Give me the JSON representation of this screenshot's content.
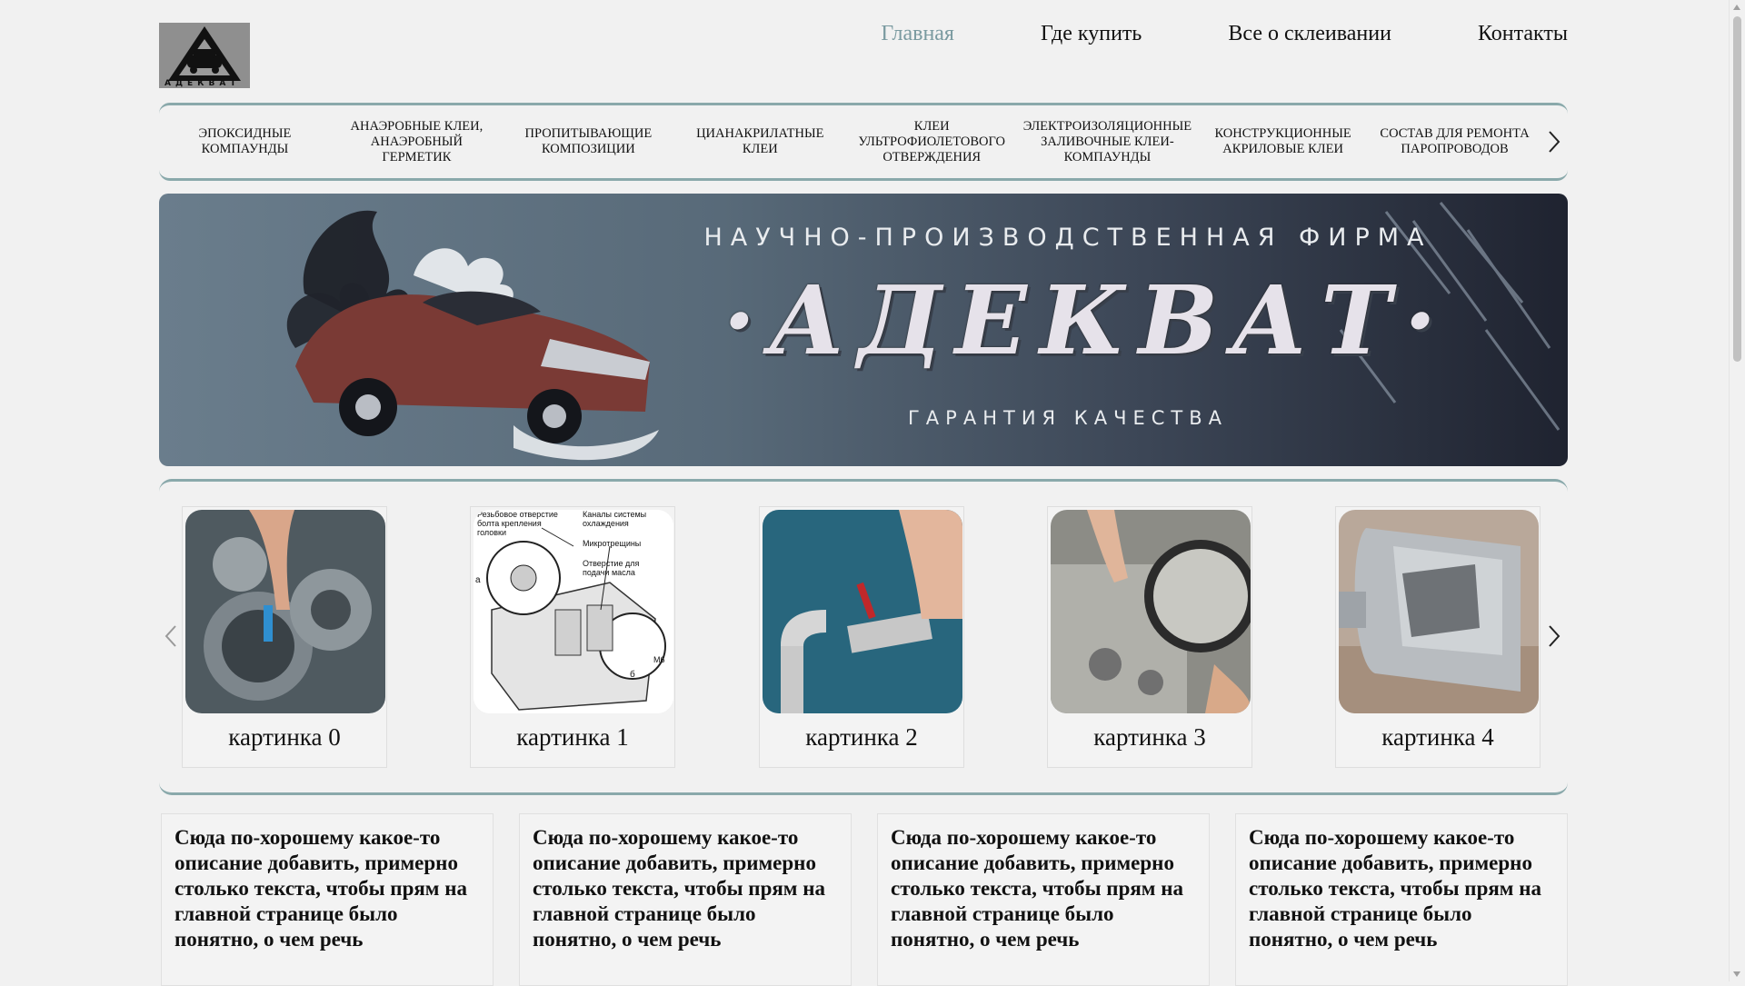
{
  "logo": {
    "text": "АДЕКВАТ"
  },
  "nav": {
    "items": [
      {
        "label": "Главная",
        "active": true
      },
      {
        "label": "Где купить",
        "active": false
      },
      {
        "label": "Все о склеивании",
        "active": false
      },
      {
        "label": "Контакты",
        "active": false
      }
    ]
  },
  "categories": [
    "ЭПОКСИДНЫЕ КОМПАУНДЫ",
    "АНАЭРОБНЫЕ КЛЕИ, АНАЭРОБНЫЙ ГЕРМЕТИК",
    "ПРОПИТЫВАЮЩИЕ КОМПОЗИЦИИ",
    "ЦИАНАКРИЛАТНЫЕ КЛЕИ",
    "КЛЕИ УЛЬТРОФИОЛЕТОВОГО ОТВЕРЖДЕНИЯ",
    "ЭЛЕКТРОИЗОЛЯЦИОННЫЕ ЗАЛИВОЧНЫЕ КЛЕИ-КОМПАУНДЫ",
    "КОНСТРУКЦИОННЫЕ АКРИЛОВЫЕ КЛЕИ",
    "СОСТАВ ДЛЯ РЕМОНТА ПАРОПРОВОДОВ"
  ],
  "banner": {
    "line1": "НАУЧНО-ПРОИЗВОДСТВЕННАЯ ФИРМА",
    "line2": "·АДЕКВАТ·",
    "line3": "ГАРАНТИЯ КАЧЕСТВА"
  },
  "gallery": {
    "items": [
      {
        "caption": "картинка 0"
      },
      {
        "caption": "картинка 1"
      },
      {
        "caption": "картинка 2"
      },
      {
        "caption": "картинка 3"
      },
      {
        "caption": "картинка 4"
      }
    ],
    "diagram_labels": {
      "l1": "Резьбовое отверстие болта крепления головки",
      "l2": "Каналы системы охлаждения",
      "l3": "Микротрещины",
      "l4": "Отверстие для подачи масла",
      "l5": "а",
      "l6": "б",
      "l7": "М6"
    }
  },
  "descriptions": [
    "Сюда по-хорошему какое-то описание добавить, примерно столько текста, чтобы прям на главной странице было понятно, о чем речь",
    "Сюда по-хорошему какое-то описание добавить, примерно столько текста, чтобы прям на главной странице было понятно, о чем речь",
    "Сюда по-хорошему какое-то описание добавить, примерно столько текста, чтобы прям на главной странице было понятно, о чем речь",
    "Сюда по-хорошему какое-то описание добавить, примерно столько текста, чтобы прям на главной странице было понятно, о чем речь"
  ],
  "colors": {
    "accent": "#8aa9ab",
    "nav_active": "#7a9aa0",
    "background": "#f1f1f1"
  },
  "icons": {
    "next": "chevron-right-icon",
    "prev": "chevron-left-icon"
  }
}
